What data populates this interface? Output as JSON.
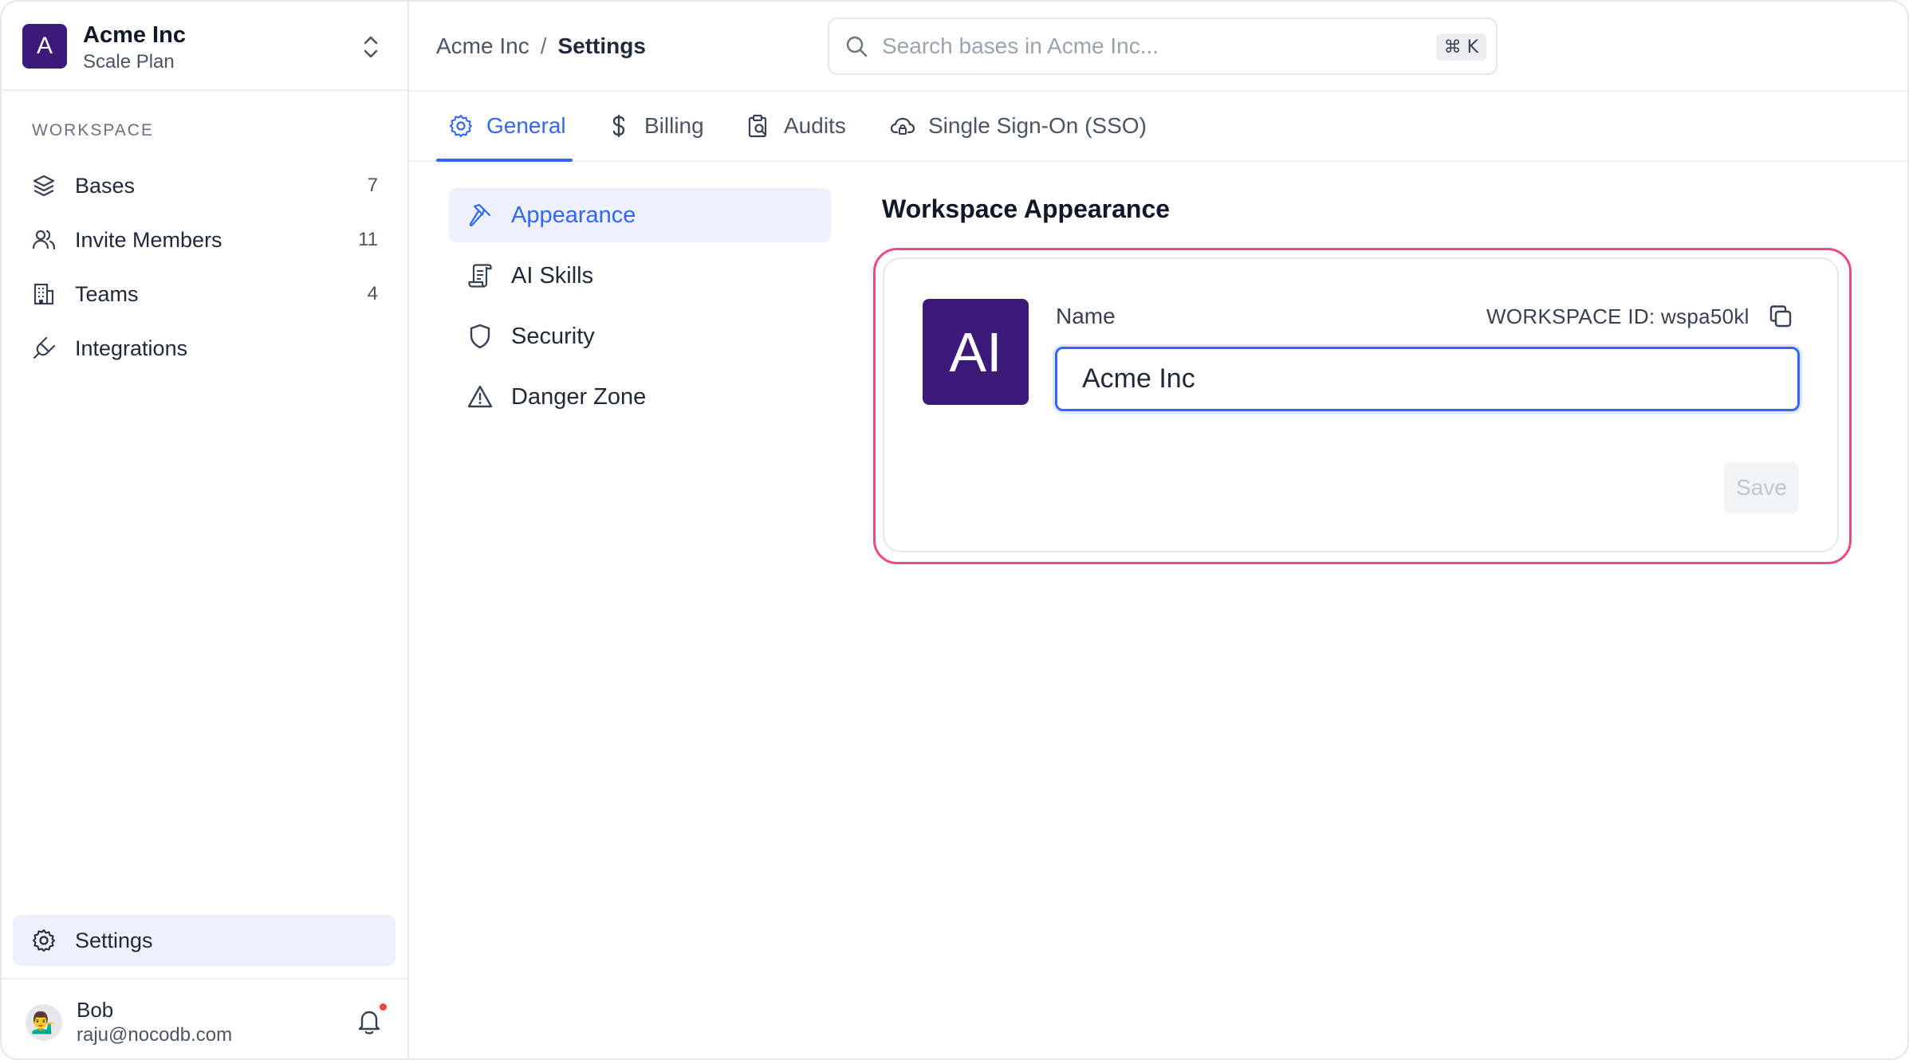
{
  "workspace": {
    "avatar_letter": "A",
    "name": "Acme Inc",
    "plan": "Scale Plan"
  },
  "sidebar": {
    "section_label": "WORKSPACE",
    "items": [
      {
        "label": "Bases",
        "count": "7",
        "icon": "layers-icon"
      },
      {
        "label": "Invite Members",
        "count": "11",
        "icon": "users-icon"
      },
      {
        "label": "Teams",
        "count": "4",
        "icon": "building-icon"
      },
      {
        "label": "Integrations",
        "count": "",
        "icon": "plug-icon"
      }
    ],
    "settings_label": "Settings"
  },
  "user": {
    "avatar_emoji": "💁‍♂️",
    "name": "Bob",
    "email": "raju@nocodb.com"
  },
  "breadcrumb": {
    "parent": "Acme Inc",
    "separator": "/",
    "current": "Settings"
  },
  "search": {
    "placeholder": "Search bases in Acme Inc...",
    "shortcut": "⌘ K"
  },
  "tabs": [
    {
      "label": "General",
      "icon": "gear-icon",
      "active": true
    },
    {
      "label": "Billing",
      "icon": "dollar-icon",
      "active": false
    },
    {
      "label": "Audits",
      "icon": "clipboard-search-icon",
      "active": false
    },
    {
      "label": "Single Sign-On (SSO)",
      "icon": "cloud-lock-icon",
      "active": false
    }
  ],
  "submenu": [
    {
      "label": "Appearance",
      "icon": "brush-icon",
      "active": true
    },
    {
      "label": "AI Skills",
      "icon": "scroll-icon",
      "active": false
    },
    {
      "label": "Security",
      "icon": "shield-icon",
      "active": false
    },
    {
      "label": "Danger Zone",
      "icon": "warning-icon",
      "active": false
    }
  ],
  "main": {
    "title": "Workspace Appearance",
    "avatar_text": "AI",
    "name_label": "Name",
    "workspace_id": "WORKSPACE ID: wspa50kl",
    "name_value": "Acme Inc",
    "save_label": "Save"
  },
  "colors": {
    "accent": "#3366ff",
    "brand_purple": "#3b1a7a",
    "highlight": "#ea4a86"
  }
}
